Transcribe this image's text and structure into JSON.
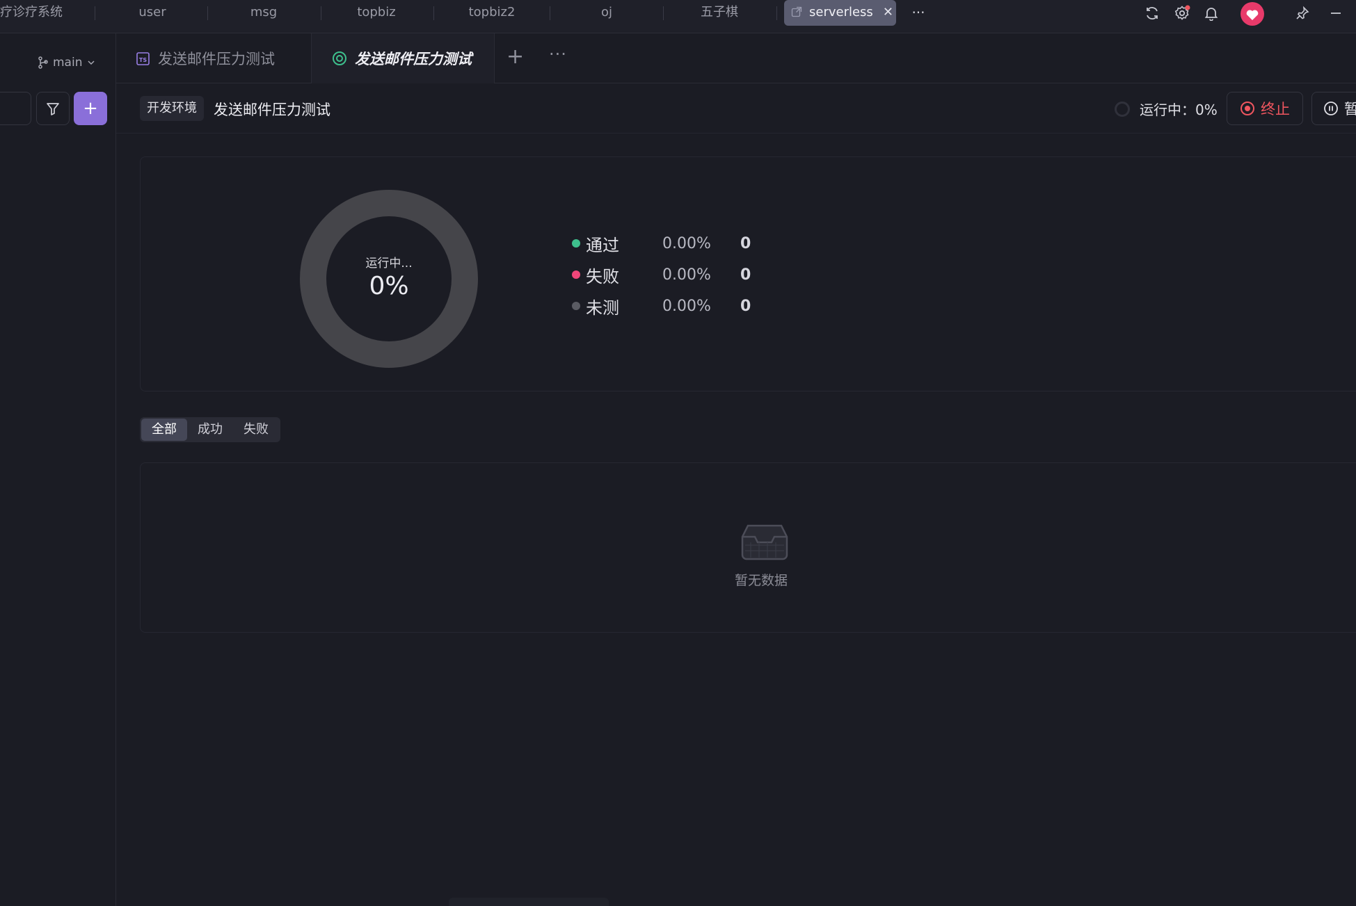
{
  "project_tabs": [
    {
      "label": "疗诊疗系统"
    },
    {
      "label": "user"
    },
    {
      "label": "msg"
    },
    {
      "label": "topbiz"
    },
    {
      "label": "topbiz2"
    },
    {
      "label": "oj"
    },
    {
      "label": "五子棋"
    },
    {
      "label": "serverless"
    }
  ],
  "project_more": "···",
  "toolbar_icons": [
    "refresh-icon",
    "settings-icon",
    "bell-icon",
    "avatar",
    "pin-icon",
    "minimize-icon"
  ],
  "sidebar": {
    "branch": "main",
    "add": "+"
  },
  "doc_tabs": [
    {
      "label": "发送邮件压力测试",
      "icon": "ts-file-icon"
    },
    {
      "label": "发送邮件压力测试",
      "icon": "test-run-icon"
    }
  ],
  "tab_actions": {
    "add": "+",
    "more": "···"
  },
  "header": {
    "env": "开发环境",
    "title": "发送邮件压力测试",
    "status": "运行中：0%",
    "stop": "终止",
    "pause": "暂"
  },
  "summary": {
    "state": "运行中...",
    "percent": "0%",
    "rows": [
      {
        "name": "通过",
        "pct": "0.00%",
        "count": "0",
        "color": "#3ec08d"
      },
      {
        "name": "失败",
        "pct": "0.00%",
        "count": "0",
        "color": "#f0467a"
      },
      {
        "name": "未测",
        "pct": "0.00%",
        "count": "0",
        "color": "#5a5b63"
      }
    ]
  },
  "result_filter": [
    {
      "label": "全部"
    },
    {
      "label": "成功"
    },
    {
      "label": "失败"
    }
  ],
  "empty_text": "暂无数据",
  "colors": {
    "accent": "#8a6fd9",
    "danger": "#f0565f",
    "active_tab_icon": "#3ec08d",
    "donut_ring": "#45454a"
  }
}
